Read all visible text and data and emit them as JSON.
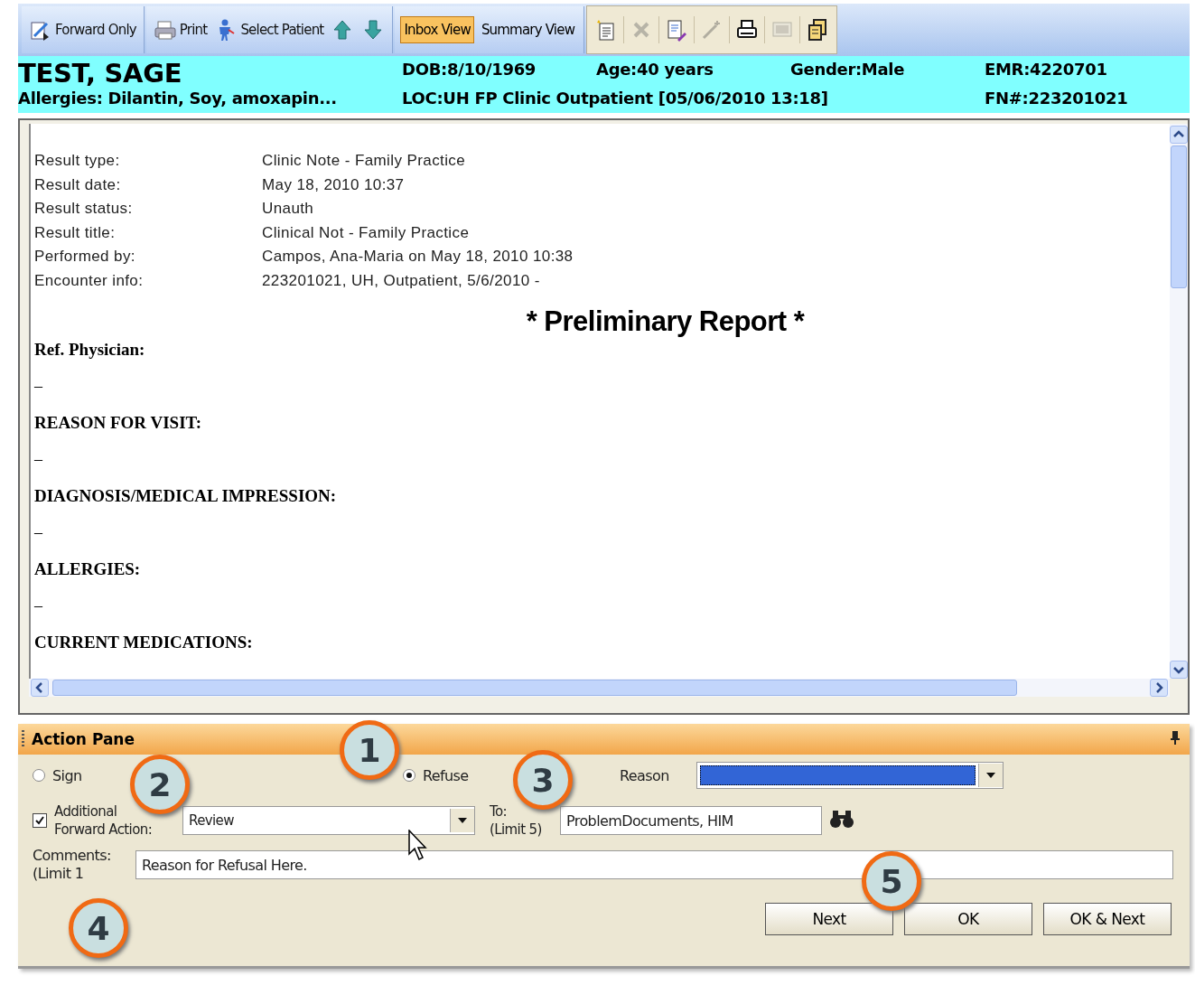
{
  "toolbar": {
    "groups": [
      {
        "items": [
          {
            "kind": "button",
            "label": "Forward Only"
          }
        ]
      },
      {
        "items": [
          {
            "kind": "button",
            "label": "Print"
          },
          {
            "kind": "button",
            "label": "Select Patient"
          },
          {
            "kind": "button"
          },
          {
            "kind": "button"
          }
        ]
      },
      {
        "items": [
          {
            "kind": "toggle",
            "label": "Inbox View",
            "selected": true
          },
          {
            "kind": "toggle",
            "label": "Summary View",
            "selected": false
          }
        ]
      },
      {
        "items": [
          {
            "kind": "button",
            "disabled": false
          },
          {
            "kind": "button",
            "disabled": true
          },
          {
            "kind": "button",
            "disabled": false
          },
          {
            "kind": "button",
            "disabled": true
          },
          {
            "kind": "button",
            "disabled": false
          },
          {
            "kind": "button",
            "disabled": true
          },
          {
            "kind": "button",
            "disabled": false
          }
        ]
      }
    ]
  },
  "patient": {
    "name": "TEST, SAGE",
    "dob": "DOB:8/10/1969",
    "age": "Age:40 years",
    "gender": "Gender:Male",
    "emr": "EMR:4220701",
    "allergies": "Allergies: Dilantin, Soy, amoxapin...",
    "location": "LOC:UH FP Clinic  Outpatient [05/06/2010 13:18]",
    "fin": "FN#:223201021"
  },
  "document": {
    "fields": [
      {
        "label": "Result type:",
        "value": "Clinic Note - Family Practice"
      },
      {
        "label": "Result date:",
        "value": "May 18, 2010 10:37"
      },
      {
        "label": "Result status:",
        "value": "Unauth"
      },
      {
        "label": "Result title:",
        "value": "Clinical Not - Family Practice"
      },
      {
        "label": "Performed by:",
        "value": "Campos, Ana-Maria on May 18, 2010 10:38"
      },
      {
        "label": "Encounter info:",
        "value": "223201021, UH, Outpatient, 5/6/2010 -"
      }
    ],
    "report_title": "* Preliminary Report *",
    "sections": [
      {
        "title": "Ref. Physician:",
        "body": "–"
      },
      {
        "title": "REASON FOR VISIT:",
        "body": "–"
      },
      {
        "title": "DIAGNOSIS/MEDICAL IMPRESSION:",
        "body": "–"
      },
      {
        "title": "ALLERGIES:",
        "body": "–"
      },
      {
        "title": "CURRENT MEDICATIONS:"
      }
    ]
  },
  "action_pane": {
    "title": "Action Pane",
    "actions": [
      {
        "label": "Sign",
        "selected": false
      },
      {
        "label": "Refuse",
        "selected": true
      }
    ],
    "reason": {
      "label": "Reason",
      "focused": true
    },
    "forward": {
      "label": "Additional Forward Action:",
      "checked": true,
      "value": "Review"
    },
    "to": {
      "label": "To:",
      "limit": "(Limit 5)",
      "value": "ProblemDocuments, HIM"
    },
    "comments": {
      "label": "Comments:",
      "limit": "(Limit 1",
      "value": "Reason for Refusal Here."
    },
    "buttons": [
      "Next",
      "OK",
      "OK & Next"
    ]
  },
  "callouts": [
    {
      "number": "1"
    },
    {
      "number": "2"
    },
    {
      "number": "3"
    },
    {
      "number": "4"
    },
    {
      "number": "5"
    }
  ]
}
